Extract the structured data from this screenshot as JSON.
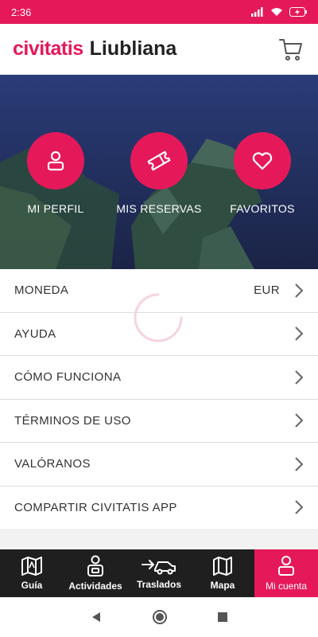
{
  "status_bar": {
    "time": "2:36"
  },
  "header": {
    "brand": "civitatis",
    "city": "Liubliana"
  },
  "shortcuts": [
    {
      "label": "MI PERFIL",
      "icon": "user-icon"
    },
    {
      "label": "MIS RESERVAS",
      "icon": "ticket-icon"
    },
    {
      "label": "FAVORITOS",
      "icon": "heart-icon"
    }
  ],
  "menu": [
    {
      "label": "MONEDA",
      "value": "EUR"
    },
    {
      "label": "AYUDA"
    },
    {
      "label": "CÓMO FUNCIONA"
    },
    {
      "label": "TÉRMINOS DE USO"
    },
    {
      "label": "VALÓRANOS"
    },
    {
      "label": "COMPARTIR CIVITATIS APP"
    }
  ],
  "bottom_nav": [
    {
      "label": "Guía",
      "icon": "map-guide-icon"
    },
    {
      "label": "Actividades",
      "icon": "activities-icon"
    },
    {
      "label": "Traslados",
      "icon": "transfer-car-icon"
    },
    {
      "label": "Mapa",
      "icon": "map-icon"
    },
    {
      "label": "Mi cuenta",
      "icon": "account-icon",
      "active": true
    }
  ],
  "colors": {
    "brand": "#e5195a",
    "nav_bg": "#1f1f1f",
    "text": "#333333"
  }
}
